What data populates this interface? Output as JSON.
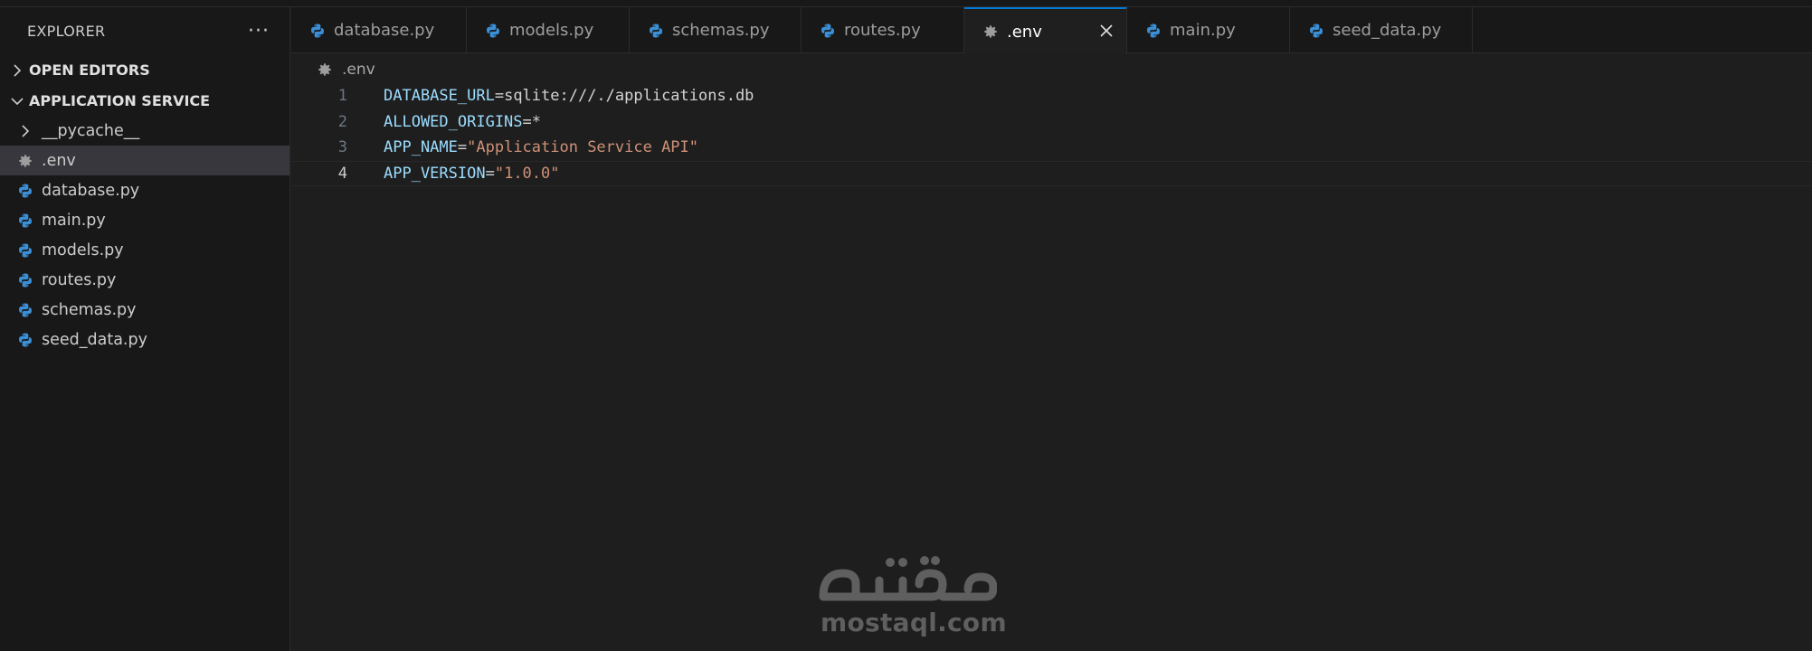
{
  "explorer": {
    "title": "EXPLORER",
    "more_label": "···",
    "open_editors_label": "OPEN EDITORS",
    "project_label": "APPLICATION SERVICE",
    "items": [
      {
        "label": "__pycache__",
        "type": "folder"
      },
      {
        "label": ".env",
        "type": "env",
        "selected": true
      },
      {
        "label": "database.py",
        "type": "python"
      },
      {
        "label": "main.py",
        "type": "python"
      },
      {
        "label": "models.py",
        "type": "python"
      },
      {
        "label": "routes.py",
        "type": "python"
      },
      {
        "label": "schemas.py",
        "type": "python"
      },
      {
        "label": "seed_data.py",
        "type": "python"
      }
    ]
  },
  "tabs": [
    {
      "label": "database.py",
      "icon": "python-icon"
    },
    {
      "label": "models.py",
      "icon": "python-icon"
    },
    {
      "label": "schemas.py",
      "icon": "python-icon"
    },
    {
      "label": "routes.py",
      "icon": "python-icon"
    },
    {
      "label": ".env",
      "icon": "gear-icon",
      "active": true
    },
    {
      "label": "main.py",
      "icon": "python-icon"
    },
    {
      "label": "seed_data.py",
      "icon": "python-icon"
    }
  ],
  "breadcrumb": {
    "file": ".env"
  },
  "editor": {
    "lines": [
      {
        "num": "1",
        "key": "DATABASE_URL",
        "eq": "=",
        "value": "sqlite:///./applications.db",
        "value_type": "plain"
      },
      {
        "num": "2",
        "key": "ALLOWED_ORIGINS",
        "eq": "=",
        "value": "*",
        "value_type": "plain"
      },
      {
        "num": "3",
        "key": "APP_NAME",
        "eq": "=",
        "value": "\"Application Service API\"",
        "value_type": "string"
      },
      {
        "num": "4",
        "key": "APP_VERSION",
        "eq": "=",
        "value": "\"1.0.0\"",
        "value_type": "string"
      }
    ],
    "current_line": 4
  },
  "watermark": {
    "text": "mostaql.com",
    "logo": "مستقل"
  },
  "colors": {
    "accent": "#0078d4",
    "python_icon": "#3b8fd6",
    "key": "#9cdcfe",
    "string": "#ce9178"
  }
}
